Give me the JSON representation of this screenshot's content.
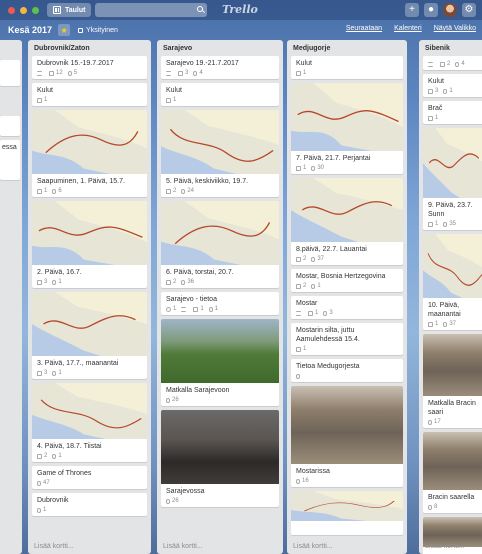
{
  "header": {
    "boards_label": "Taulut",
    "logo": "Trello",
    "icons": [
      "plus-icon",
      "bell-icon",
      "info-icon",
      "gear-icon"
    ]
  },
  "board": {
    "title": "Kesä 2017",
    "visibility": "Yksityinen",
    "follow": "Seuraataan",
    "calendar": "Kalenteri",
    "menu": "Näytä Valikko"
  },
  "partial_left_list": {
    "cards": [
      "",
      "",
      "essa"
    ]
  },
  "lists": [
    {
      "title": "Dubrovnik/Zaton",
      "add_card": "Lisää kortti...",
      "cards": [
        {
          "title": "Dubrovnik 15.-19.7.2017",
          "badges": [
            {
              "icon": "lines-icon",
              "text": ""
            },
            {
              "icon": "comment-icon",
              "text": "12"
            },
            {
              "icon": "attachment-icon",
              "text": "5"
            }
          ]
        },
        {
          "title": "Kulut",
          "badges": [
            {
              "icon": "comment-icon",
              "text": "1"
            }
          ]
        },
        {
          "title": "Saapuminen, 1. Päivä, 15.7.",
          "cover": "map",
          "badges": [
            {
              "icon": "comment-icon",
              "text": "1"
            },
            {
              "icon": "attachment-icon",
              "text": "6"
            }
          ]
        },
        {
          "title": "2. Päivä, 16.7.",
          "cover": "map",
          "badges": [
            {
              "icon": "comment-icon",
              "text": "3"
            },
            {
              "icon": "attachment-icon",
              "text": "1"
            }
          ]
        },
        {
          "title": "3. Päivä, 17.7., maanantai",
          "cover": "map",
          "badges": [
            {
              "icon": "comment-icon",
              "text": "3"
            },
            {
              "icon": "attachment-icon",
              "text": "1"
            }
          ]
        },
        {
          "title": "4. Päivä, 18.7. Tiistai",
          "cover": "map",
          "badges": [
            {
              "icon": "comment-icon",
              "text": "2"
            },
            {
              "icon": "attachment-icon",
              "text": "1"
            }
          ]
        },
        {
          "title": "Game of Thrones",
          "badges": [
            {
              "icon": "attachment-icon",
              "text": "47"
            }
          ]
        },
        {
          "title": "Dubrovnik",
          "badges": [
            {
              "icon": "attachment-icon",
              "text": "1"
            }
          ]
        }
      ]
    },
    {
      "title": "Sarajevo",
      "add_card": "Lisää kortti...",
      "cards": [
        {
          "title": "Sarajevo 19.-21.7.2017",
          "badges": [
            {
              "icon": "lines-icon",
              "text": ""
            },
            {
              "icon": "comment-icon",
              "text": "3"
            },
            {
              "icon": "attachment-icon",
              "text": "4"
            }
          ]
        },
        {
          "title": "Kulut",
          "badges": [
            {
              "icon": "comment-icon",
              "text": "1"
            }
          ]
        },
        {
          "title": "5. Päivä, keskiviikko, 19.7.",
          "cover": "map",
          "badges": [
            {
              "icon": "comment-icon",
              "text": "2"
            },
            {
              "icon": "attachment-icon",
              "text": "24"
            }
          ]
        },
        {
          "title": "6. Päivä, torstai, 20.7.",
          "cover": "map",
          "badges": [
            {
              "icon": "comment-icon",
              "text": "2"
            },
            {
              "icon": "attachment-icon",
              "text": "36"
            }
          ]
        },
        {
          "title": "Sarajevo - tietoa",
          "badges": [
            {
              "icon": "label-icon",
              "text": "1"
            },
            {
              "icon": "lines-icon",
              "text": ""
            },
            {
              "icon": "comment-icon",
              "text": "1"
            },
            {
              "icon": "attachment-icon",
              "text": "1"
            }
          ]
        },
        {
          "title": "Matkalla Sarajevoon",
          "cover": "park",
          "badges": [
            {
              "icon": "attachment-icon",
              "text": "26"
            }
          ]
        },
        {
          "title": "Sarajevossa",
          "cover": "room",
          "badges": [
            {
              "icon": "attachment-icon",
              "text": "26"
            }
          ]
        }
      ]
    },
    {
      "title": "Medjugorje",
      "add_card": "Lisää kortti...",
      "cards": [
        {
          "title": "Kulut",
          "badges": [
            {
              "icon": "comment-icon",
              "text": "1"
            }
          ]
        },
        {
          "title": "7. Päivä, 21.7. Perjantai",
          "cover": "map",
          "badges": [
            {
              "icon": "comment-icon",
              "text": "1"
            },
            {
              "icon": "attachment-icon",
              "text": "30"
            }
          ]
        },
        {
          "title": "8.päivä, 22.7. Lauantai",
          "cover": "map",
          "badges": [
            {
              "icon": "comment-icon",
              "text": "2"
            },
            {
              "icon": "attachment-icon",
              "text": "37"
            }
          ]
        },
        {
          "title": "Mostar, Bosnia Hertzegovina",
          "badges": [
            {
              "icon": "comment-icon",
              "text": "2"
            },
            {
              "icon": "attachment-icon",
              "text": "1"
            }
          ]
        },
        {
          "title": "Mostar",
          "badges": [
            {
              "icon": "lines-icon",
              "text": ""
            },
            {
              "icon": "comment-icon",
              "text": "1"
            },
            {
              "icon": "attachment-icon",
              "text": "3"
            }
          ]
        },
        {
          "title": "Mostarin silta, juttu Aamulehdessä 15.4.",
          "badges": [
            {
              "icon": "comment-icon",
              "text": "1"
            }
          ]
        },
        {
          "title": "Tietoa Medugorjesta",
          "badges": [
            {
              "icon": "attachment-icon",
              "text": ""
            }
          ]
        },
        {
          "title": "Mostarissa",
          "cover": "town",
          "badges": [
            {
              "icon": "attachment-icon",
              "text": "16"
            }
          ]
        },
        {
          "title": "",
          "cover": "map",
          "badges": []
        }
      ]
    },
    {
      "title": "Sibenik",
      "add_card": "Lisää kortti...",
      "cards": [
        {
          "title": "",
          "badges": [
            {
              "icon": "lines-icon",
              "text": ""
            },
            {
              "icon": "comment-icon",
              "text": "2"
            },
            {
              "icon": "attachment-icon",
              "text": "4"
            }
          ]
        },
        {
          "title": "Kulut",
          "badges": [
            {
              "icon": "comment-icon",
              "text": "3"
            },
            {
              "icon": "attachment-icon",
              "text": "1"
            }
          ]
        },
        {
          "title": "Brač",
          "badges": [
            {
              "icon": "comment-icon",
              "text": "1"
            }
          ]
        },
        {
          "title": "9. Päivä, 23.7. Sunn",
          "cover": "map",
          "badges": [
            {
              "icon": "comment-icon",
              "text": "1"
            },
            {
              "icon": "attachment-icon",
              "text": "35"
            }
          ]
        },
        {
          "title": "10. Päivä, maanantai",
          "cover": "map",
          "badges": [
            {
              "icon": "comment-icon",
              "text": "1"
            },
            {
              "icon": "attachment-icon",
              "text": "37"
            }
          ]
        },
        {
          "title": "Matkalla Bracin saari",
          "cover": "town",
          "badges": [
            {
              "icon": "attachment-icon",
              "text": "17"
            }
          ]
        },
        {
          "title": "Bracin saarella",
          "cover": "town",
          "badges": [
            {
              "icon": "attachment-icon",
              "text": "8"
            }
          ]
        },
        {
          "title": "",
          "cover": "town",
          "badges": []
        }
      ]
    }
  ]
}
